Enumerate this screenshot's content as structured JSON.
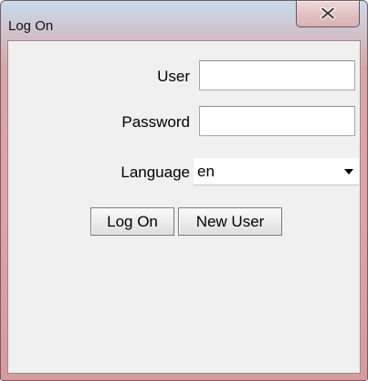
{
  "window": {
    "title": "Log On"
  },
  "icons": {
    "close": "close-icon"
  },
  "form": {
    "user_label": "User",
    "user_value": "",
    "password_label": "Password",
    "password_value": "",
    "language_label": "Language",
    "language_value": "en"
  },
  "buttons": {
    "log_on_label": "Log On",
    "new_user_label": "New User"
  }
}
